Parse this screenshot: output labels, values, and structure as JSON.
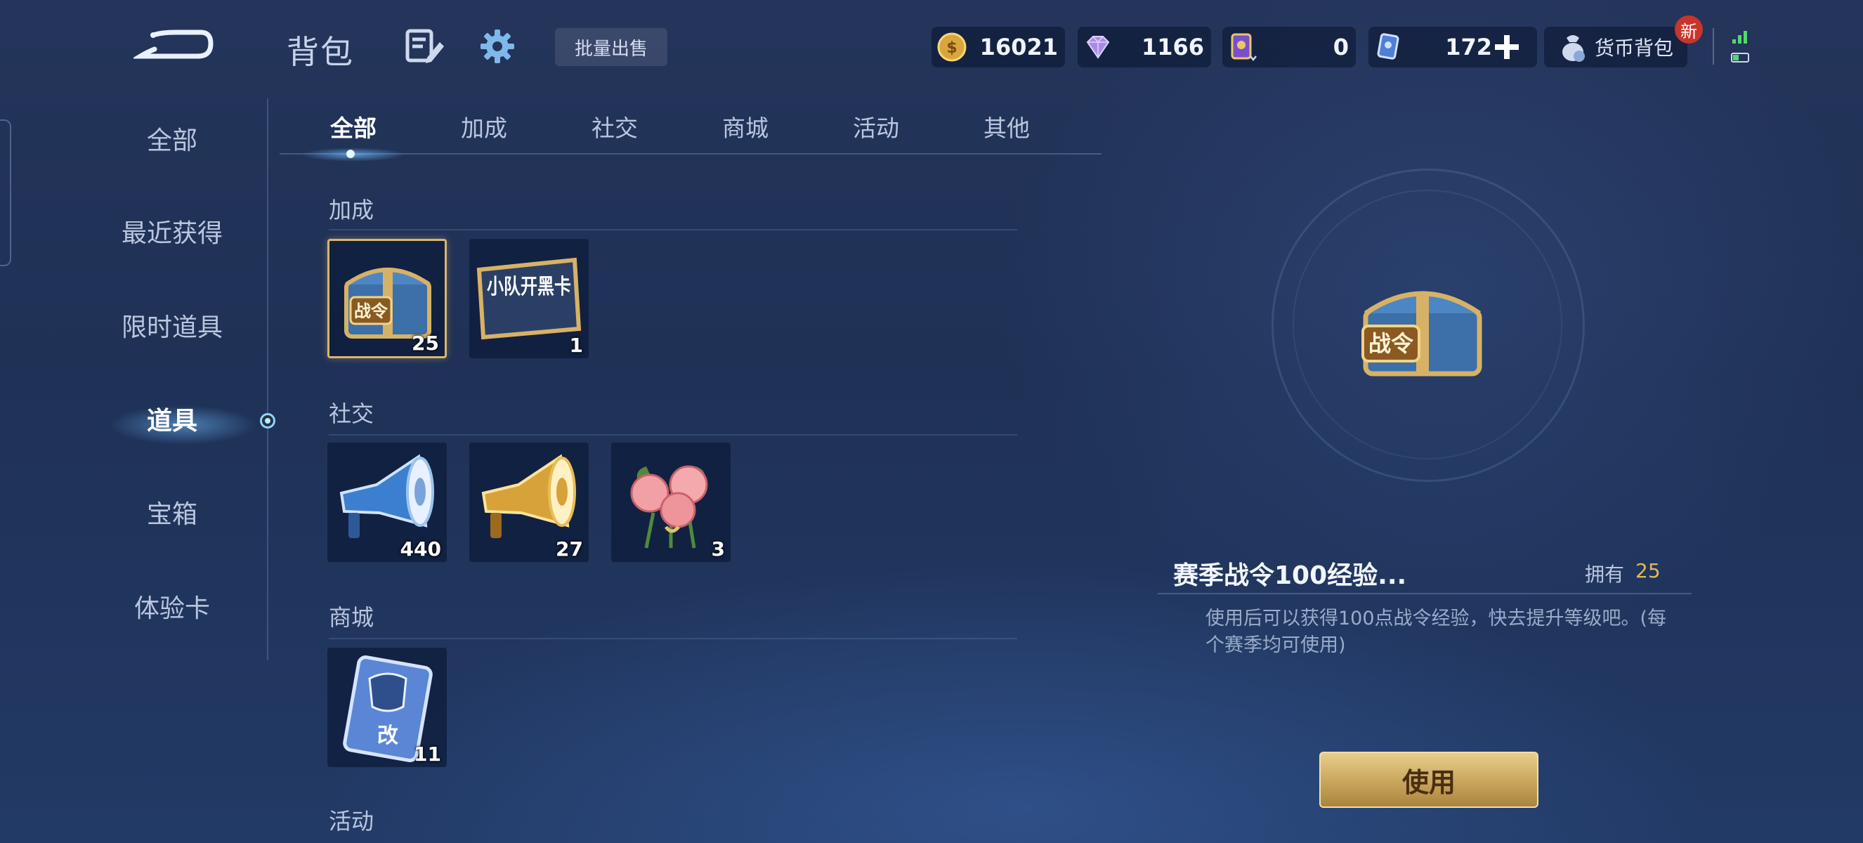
{
  "header": {
    "title": "背包",
    "bulk_sell": "批量出售",
    "currencies": [
      {
        "name": "gold-coin",
        "value": "16021"
      },
      {
        "name": "diamond",
        "value": "1166"
      },
      {
        "name": "purple-ticket",
        "value": "0"
      },
      {
        "name": "blue-ticket",
        "value": "172"
      }
    ],
    "wallet_label": "货币背包",
    "new_badge": "新"
  },
  "sidebar": {
    "items": [
      {
        "label": "全部"
      },
      {
        "label": "最近获得"
      },
      {
        "label": "限时道具"
      },
      {
        "label": "道具"
      },
      {
        "label": "宝箱"
      },
      {
        "label": "体验卡"
      }
    ],
    "active_index": 3
  },
  "tabs": [
    {
      "label": "全部"
    },
    {
      "label": "加成"
    },
    {
      "label": "社交"
    },
    {
      "label": "商城"
    },
    {
      "label": "活动"
    },
    {
      "label": "其他"
    }
  ],
  "sections": [
    {
      "title": "加成",
      "items": [
        {
          "icon": "battle-pass-chest-icon",
          "art_text": "战令",
          "count": "25",
          "selected": true
        },
        {
          "icon": "squad-card-icon",
          "art_text": "小队开黑卡",
          "count": "1"
        }
      ]
    },
    {
      "title": "社交",
      "items": [
        {
          "icon": "blue-megaphone-icon",
          "count": "440"
        },
        {
          "icon": "gold-megaphone-icon",
          "count": "27"
        },
        {
          "icon": "rose-bouquet-icon",
          "count": "3"
        }
      ]
    },
    {
      "title": "商城",
      "items": [
        {
          "icon": "rename-card-icon",
          "art_text": "改",
          "count": "11"
        }
      ]
    },
    {
      "title": "活动",
      "items": []
    }
  ],
  "detail": {
    "art_text": "战令",
    "name": "赛季战令100经验...",
    "own_label": "拥有",
    "own_count": "25",
    "description": "使用后可以获得100点战令经验，快去提升等级吧。(每个赛季均可使用)",
    "use_button": "使用"
  },
  "colors": {
    "accent_gold": "#d9b56b",
    "own_count": "#e3b85c",
    "button_gold": "#c8a55c",
    "badge_red": "#c8352b"
  }
}
